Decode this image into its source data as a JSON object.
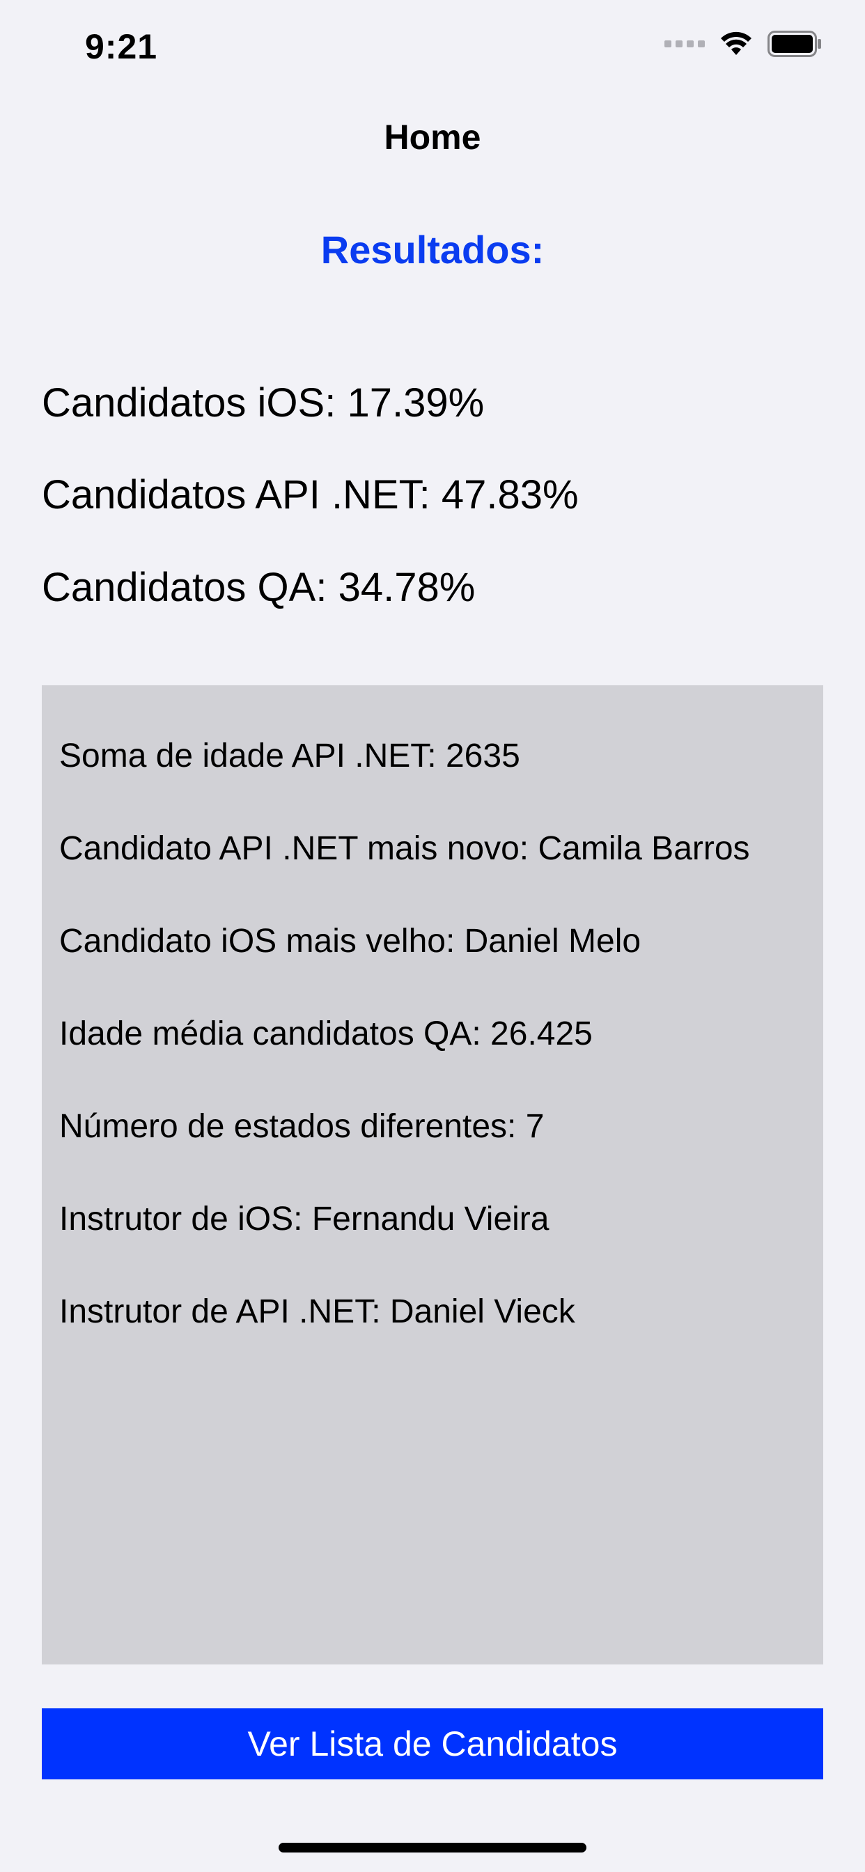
{
  "status_bar": {
    "time": "9:21",
    "icons": [
      "cellular-signal-icon",
      "wifi-icon",
      "battery-icon"
    ]
  },
  "nav": {
    "title": "Home"
  },
  "results": {
    "heading": "Resultados:",
    "heading_color": "#0a3cf0",
    "stats": [
      "Candidatos iOS: 17.39%",
      "Candidatos API .NET: 47.83%",
      "Candidatos QA: 34.78%"
    ]
  },
  "info_panel": {
    "lines": [
      "Soma de idade API .NET: 2635",
      "Candidato API .NET mais novo: Camila Barros",
      "Candidato iOS mais velho: Daniel Melo",
      "Idade média candidatos QA: 26.425",
      "Número de estados diferentes: 7",
      "Instrutor de iOS: Fernandu Vieira",
      "Instrutor de API .NET: Daniel Vieck"
    ]
  },
  "actions": {
    "view_list_label": "Ver Lista de Candidatos",
    "button_color": "#0033ff"
  }
}
